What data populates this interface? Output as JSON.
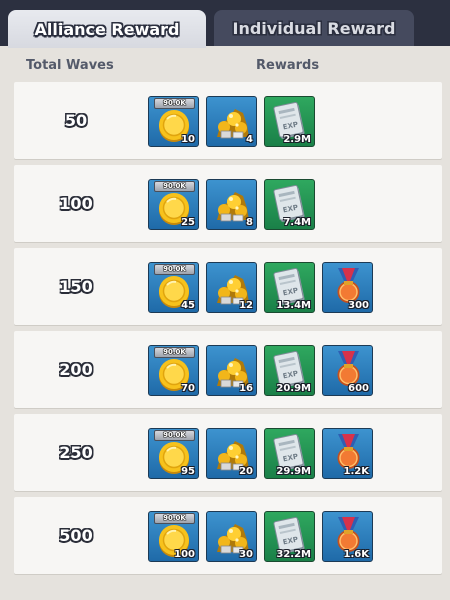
{
  "tabs": {
    "alliance_label": "Alliance Reward",
    "individual_label": "Individual Reward"
  },
  "headers": {
    "waves": "Total Waves",
    "rewards": "Rewards"
  },
  "icons": {
    "coin": "gold-coin-icon",
    "gold": "gold-pile-icon",
    "exp": "exp-book-icon",
    "medal": "medal-icon"
  },
  "colors": {
    "tab_active": "#e0e2e8",
    "tab_inactive": "#454a5e",
    "panel": "#e5e2dd",
    "row": "#f7f6f4",
    "item_blue": "#2f84c2",
    "item_green": "#25965a"
  },
  "rows": [
    {
      "waves": "50",
      "coin_tag": "90.0K",
      "coin": "10",
      "gold": "4",
      "exp": "2.9M",
      "medal": null
    },
    {
      "waves": "100",
      "coin_tag": "90.0K",
      "coin": "25",
      "gold": "8",
      "exp": "7.4M",
      "medal": null
    },
    {
      "waves": "150",
      "coin_tag": "90.0K",
      "coin": "45",
      "gold": "12",
      "exp": "13.4M",
      "medal": "300"
    },
    {
      "waves": "200",
      "coin_tag": "90.0K",
      "coin": "70",
      "gold": "16",
      "exp": "20.9M",
      "medal": "600"
    },
    {
      "waves": "250",
      "coin_tag": "90.0K",
      "coin": "95",
      "gold": "20",
      "exp": "29.9M",
      "medal": "1.2K"
    },
    {
      "waves": "500",
      "coin_tag": "90.0K",
      "coin": "100",
      "gold": "30",
      "exp": "32.2M",
      "medal": "1.6K"
    }
  ]
}
